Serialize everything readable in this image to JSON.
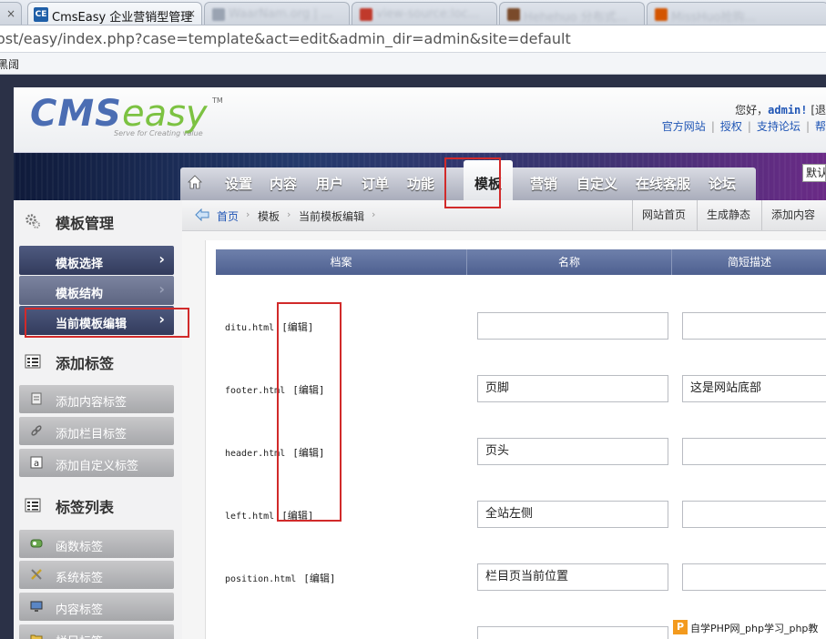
{
  "browser": {
    "tabs": [
      {
        "favicon": "CE",
        "title": "CmsEasy 企业营销型管理",
        "close": "×"
      },
      {
        "title": "WaarNam.org | ..."
      },
      {
        "title": "view-source:loc..."
      },
      {
        "title": "Hehehuo 分布式..."
      },
      {
        "title": "MissHuo抢购..."
      }
    ],
    "first_close": "×",
    "url": "ost/easy/index.php?case=template&act=edit&admin_dir=admin&site=default",
    "bookmark": "黑阔"
  },
  "header": {
    "logo_cms": "CMS",
    "logo_easy": "easy",
    "logo_tm": "TM",
    "logo_slogan": "Serve for Creating value",
    "welcome_prefix": "您好，",
    "welcome_user": "admin!",
    "welcome_suffix": " [退",
    "links": [
      "官方网站",
      "授权",
      "支持论坛",
      "帮"
    ]
  },
  "nav": {
    "items": [
      "设置",
      "内容",
      "用户",
      "订单",
      "功能",
      "模板",
      "营销",
      "自定义",
      "在线客服",
      "论坛"
    ],
    "active": "模板",
    "lang_select": "默认"
  },
  "sidebar": {
    "section1": {
      "icon": "gears-icon",
      "title": "模板管理"
    },
    "template_items": [
      {
        "label": "模板选择",
        "chev": "›"
      },
      {
        "label": "模板结构",
        "chev": "›"
      },
      {
        "label": "当前模板编辑",
        "chev": "›"
      }
    ],
    "section2": {
      "icon": "list-icon",
      "title": "添加标签"
    },
    "add_items": [
      {
        "label": "添加内容标签",
        "icon": "doc-icon"
      },
      {
        "label": "添加栏目标签",
        "icon": "link-icon"
      },
      {
        "label": "添加自定义标签",
        "icon": "a-icon"
      }
    ],
    "section3": {
      "icon": "list-icon",
      "title": "标签列表"
    },
    "list_items": [
      {
        "label": "函数标签",
        "icon": "func-icon"
      },
      {
        "label": "系统标签",
        "icon": "tools-icon"
      },
      {
        "label": "内容标签",
        "icon": "monitor-icon"
      },
      {
        "label": "栏目标签",
        "icon": "folder-icon"
      }
    ]
  },
  "breadcrumb": {
    "items": [
      "首页",
      "模板",
      "当前模板编辑"
    ],
    "sep": "›",
    "quick": [
      "网站首页",
      "生成静态",
      "添加内容"
    ]
  },
  "table": {
    "headers": [
      "档案",
      "名称",
      "简短描述"
    ],
    "edit_label": "[编辑]",
    "rows": [
      {
        "file": "ditu.html",
        "name": "",
        "desc": ""
      },
      {
        "file": "footer.html",
        "name": "页脚",
        "desc": "这是网站底部"
      },
      {
        "file": "header.html",
        "name": "页头",
        "desc": ""
      },
      {
        "file": "left.html",
        "name": "全站左侧",
        "desc": ""
      },
      {
        "file": "position.html",
        "name": "栏目页当前位置",
        "desc": ""
      }
    ]
  },
  "watermark": {
    "badge": "P",
    "text": "自学PHP网_php学习_php教"
  },
  "colors": {
    "annotation": "#d12a2a",
    "nav_dark": "#323b5c",
    "link": "#1f55b5"
  }
}
